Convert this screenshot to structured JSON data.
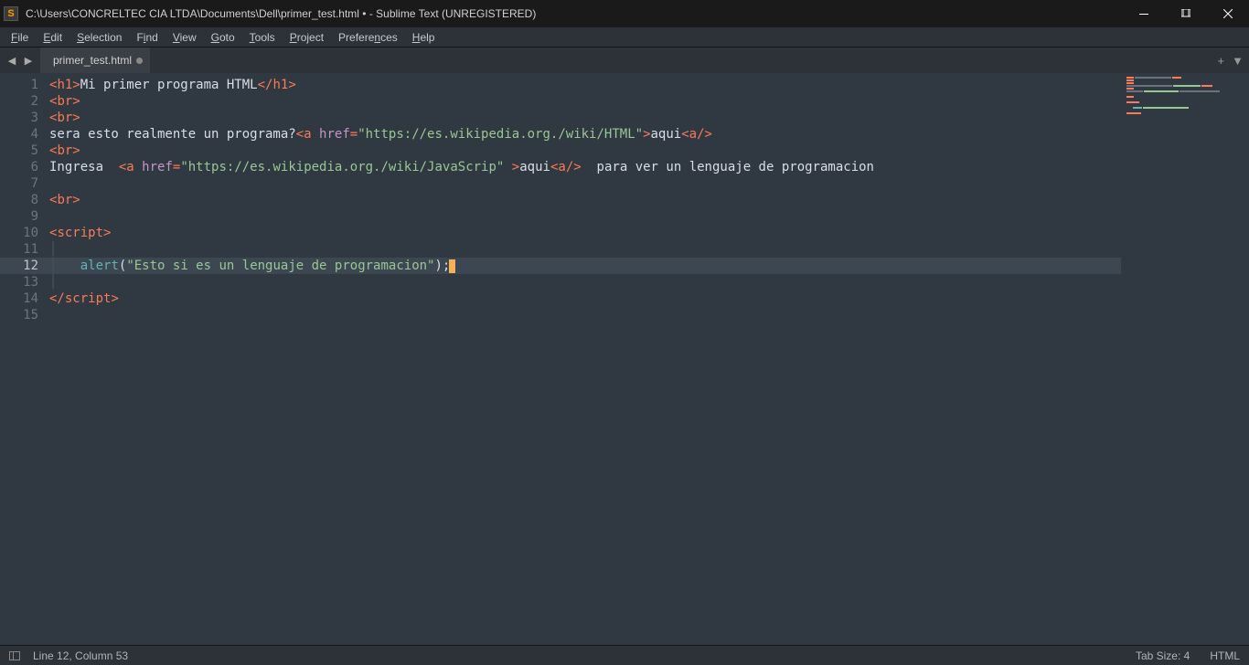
{
  "window": {
    "title": "C:\\Users\\CONCRELTEC CIA LTDA\\Documents\\Dell\\primer_test.html • - Sublime Text (UNREGISTERED)"
  },
  "menu": {
    "file": "File",
    "edit": "Edit",
    "selection": "Selection",
    "find": "Find",
    "view": "View",
    "goto": "Goto",
    "tools": "Tools",
    "project": "Project",
    "preferences": "Preferences",
    "help": "Help"
  },
  "tabs": {
    "tab1": "primer_test.html"
  },
  "gutter": {
    "l1": "1",
    "l2": "2",
    "l3": "3",
    "l4": "4",
    "l5": "5",
    "l6": "6",
    "l7": "7",
    "l8": "8",
    "l9": "9",
    "l10": "10",
    "l11": "11",
    "l12": "12",
    "l13": "13",
    "l14": "14",
    "l15": "15"
  },
  "code": {
    "l1": {
      "open": "<",
      "tag": "h1",
      "close": ">",
      "text": "Mi primer programa HTML",
      "copen": "</",
      "ctag": "h1",
      "cclose": ">"
    },
    "l2": {
      "open": "<",
      "tag": "br",
      "close": ">"
    },
    "l3": {
      "open": "<",
      "tag": "br",
      "close": ">"
    },
    "l4": {
      "pre": "sera esto realmente un programa?",
      "open": "<",
      "tag": "a",
      "sp": " ",
      "attr": "href",
      "eq": "=",
      "val": "\"https://es.wikipedia.org./wiki/HTML\"",
      "close": ">",
      "text": "aqui",
      "copen": "<",
      "ctag": "a",
      "cslash": "/",
      "cclose": ">"
    },
    "l5": {
      "open": "<",
      "tag": "br",
      "close": ">"
    },
    "l6": {
      "pre": "Ingresa  ",
      "open": "<",
      "tag": "a",
      "sp": " ",
      "attr": "href",
      "eq": "=",
      "val": "\"https://es.wikipedia.org./wiki/JavaScrip\"",
      "sp2": " ",
      "close": ">",
      "text": "aqui",
      "copen": "<",
      "ctag": "a",
      "cslash": "/",
      "cclose": ">",
      "post": "  para ver un lenguaje de programacion"
    },
    "l8": {
      "open": "<",
      "tag": "br",
      "close": ">"
    },
    "l10": {
      "open": "<",
      "tag": "script",
      "close": ">"
    },
    "l12": {
      "indent": "    ",
      "func": "alert",
      "paren": "(",
      "str": "\"Esto si es un lenguaje de programacion\"",
      "cparen": ")",
      "semi": ";"
    },
    "l14": {
      "open": "</",
      "tag": "script",
      "close": ">"
    }
  },
  "statusbar": {
    "position": "Line 12, Column 53",
    "tabsize": "Tab Size: 4",
    "syntax": "HTML"
  }
}
